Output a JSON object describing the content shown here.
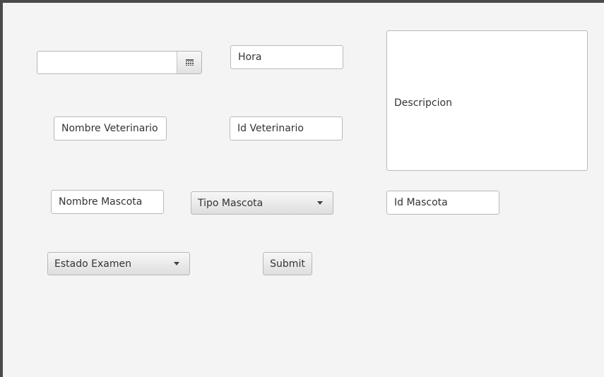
{
  "form": {
    "date": {
      "value": "",
      "icon": "calendar-icon"
    },
    "hora": {
      "value": "Hora"
    },
    "descripcion": {
      "value": "Descripcion"
    },
    "nombre_veterinario": {
      "value": "Nombre Veterinario"
    },
    "id_veterinario": {
      "value": "Id Veterinario"
    },
    "nombre_mascota": {
      "value": "Nombre Mascota"
    },
    "tipo_mascota": {
      "selected": "Tipo Mascota",
      "icon": "chevron-down-icon"
    },
    "id_mascota": {
      "value": "Id Mascota"
    },
    "estado_examen": {
      "selected": "Estado Examen",
      "icon": "chevron-down-icon"
    },
    "submit_label": "Submit"
  }
}
